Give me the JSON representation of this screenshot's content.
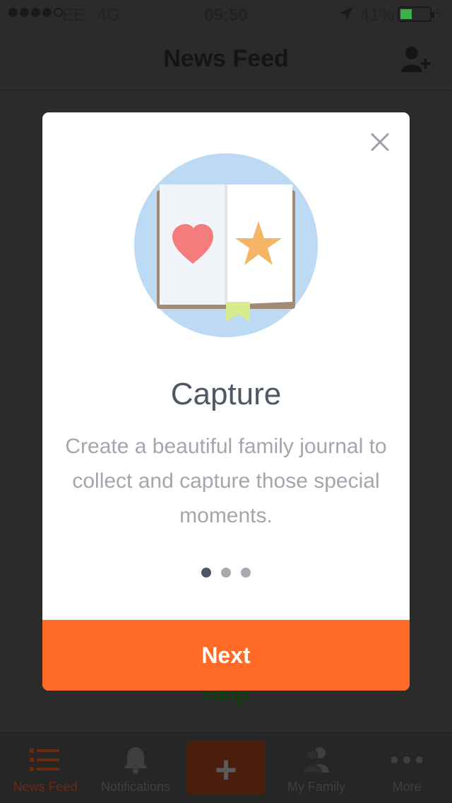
{
  "status_bar": {
    "carrier": "EE",
    "network": "4G",
    "time": "09:50",
    "battery_percent": "41%",
    "battery_level": 0.41,
    "signal_bars": 4,
    "signal_total": 5
  },
  "nav": {
    "title": "News Feed",
    "right_icon": "add-user-icon"
  },
  "background": {
    "help_link": "Help"
  },
  "modal": {
    "close_icon": "close-icon",
    "illustration_icons": [
      "open-book-icon",
      "heart-icon",
      "star-icon",
      "bookmark-icon"
    ],
    "title": "Capture",
    "body": "Create a beautiful family journal to collect and capture those special moments.",
    "page_count": 3,
    "current_page": 1,
    "next_label": "Next"
  },
  "tab_bar": {
    "tabs": [
      {
        "label": "News Feed",
        "icon": "list-icon",
        "active": true
      },
      {
        "label": "Notifications",
        "icon": "bell-icon",
        "active": false
      },
      {
        "label": "",
        "icon": "plus-icon",
        "active": false
      },
      {
        "label": "My Family",
        "icon": "family-icon",
        "active": false
      },
      {
        "label": "More",
        "icon": "more-dots-icon",
        "active": false
      }
    ]
  },
  "colors": {
    "accent": "#ff6a26",
    "title_text": "#4e5764",
    "body_text": "#a3a6ad",
    "illustration_bg": "#bcdaf3",
    "heart": "#f47c7c",
    "star": "#f5b566",
    "bookmark": "#d6ec8e"
  }
}
